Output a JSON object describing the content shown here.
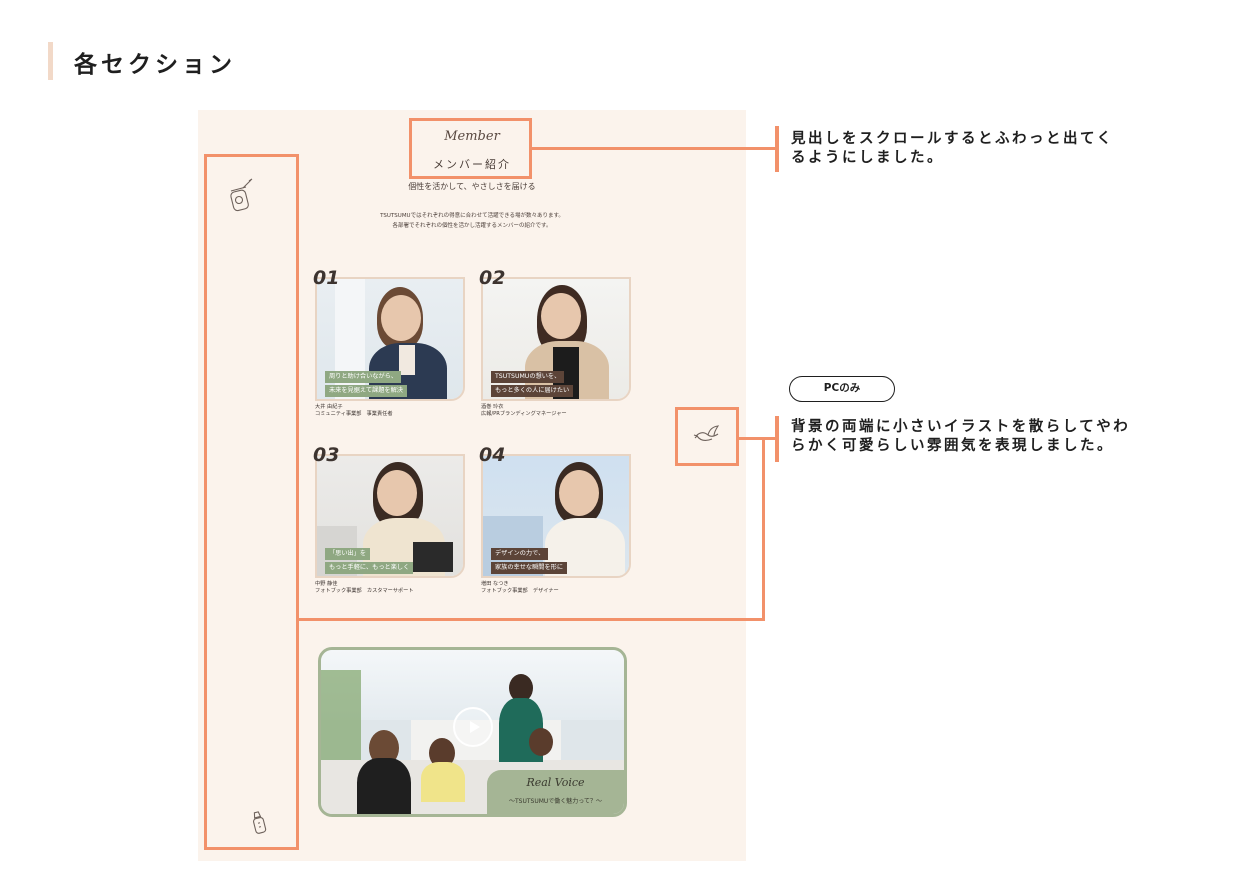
{
  "section": {
    "title": "各セクション"
  },
  "mockup": {
    "script_heading": "Member",
    "heading": "メンバー紹介",
    "subheading": "個性を活かして、やさしさを届ける",
    "intro": [
      "TSUTSUMUではそれぞれの得意に合わせて活躍できる場が数々あります。",
      "各部署でそれぞれの個性を活かし活躍するメンバーの紹介です。"
    ],
    "members": [
      {
        "number": "01",
        "caption": [
          "周りと助け合いながら、",
          "未来を見据えて課題を解決"
        ],
        "caption_color": "#8fa882",
        "name": "大井 由紀子",
        "role": "コミュニティ事業部　事業責任者"
      },
      {
        "number": "02",
        "caption": [
          "TSUTSUMUの想いを、",
          "もっと多くの人に届けたい"
        ],
        "caption_color": "#5c4438",
        "name": "酒巻 玲衣",
        "role": "広報/PRブランディングマネージャー"
      },
      {
        "number": "03",
        "caption": [
          "「思い出」を",
          "もっと手軽に、もっと楽しく"
        ],
        "caption_color": "#8fa882",
        "name": "中野 静佳",
        "role": "フォトブック事業部　カスタマーサポート"
      },
      {
        "number": "04",
        "caption": [
          "デザインの力で、",
          "家族の幸せな瞬間を形に"
        ],
        "caption_color": "#5c4438",
        "name": "増田 なつき",
        "role": "フォトブック事業部　デザイナー"
      }
    ],
    "video": {
      "title": "Real Voice",
      "subtitle": "〜TSUTSUMUで働く魅力って？〜",
      "play_icon": "play-icon"
    },
    "decor_icons": [
      "baby-food-jar-icon",
      "bird-icon",
      "baby-bottle-icon"
    ]
  },
  "annotations": {
    "heading_note": [
      "見出しをスクロールするとふわっと出てく",
      "るようにしました。"
    ],
    "badge": "PCのみ",
    "background_note": [
      "背景の両端に小さいイラストを散らしてやわ",
      "らかく可愛らしい雰囲気を表現しました。"
    ]
  },
  "colors": {
    "highlight": "#f2916a",
    "mock_background": "#fbf3ec",
    "accent_green": "#a5b595",
    "section_bar": "#f2d9c8"
  }
}
